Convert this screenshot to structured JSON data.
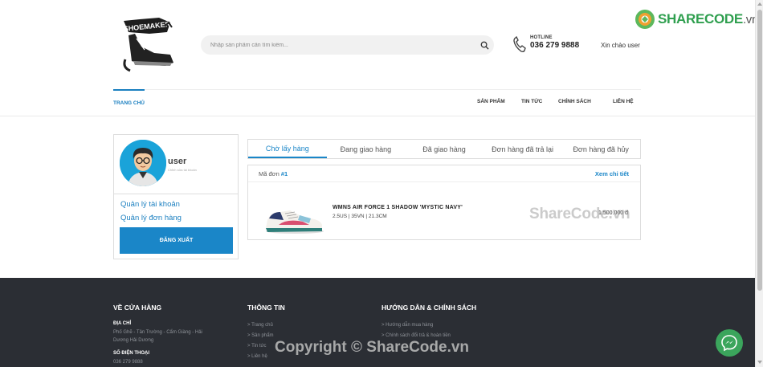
{
  "header": {
    "search_placeholder": "Nhập sản phẩm cần tìm kiếm...",
    "hotline_label": "HOTLINE",
    "hotline_number": "036 279 9888",
    "greeting": "Xin chào user"
  },
  "nav": {
    "home": "TRANG CHỦ",
    "items": [
      "SẢN PHẨM",
      "TIN TỨC",
      "CHÍNH SÁCH",
      "LIÊN HỆ"
    ]
  },
  "profile": {
    "username": "user",
    "subtitle": "Chỉnh sửa tài khoản",
    "manage_account": "Quản lý tài khoản",
    "manage_orders": "Quản lý đơn hàng",
    "logout": "ĐĂNG XUẤT"
  },
  "orders": {
    "tabs": [
      "Chờ lấy hàng",
      "Đang giao hàng",
      "Đã giao hàng",
      "Đơn hàng đã trả lại",
      "Đơn hàng đã hủy"
    ],
    "active_tab": 0,
    "order_label": "Mã đơn",
    "order_id": "#1",
    "detail_link": "Xem chi tiết",
    "product_name": "WMNS AIR FORCE 1 SHADOW 'MYSTIC NAVY'",
    "product_spec": "2.5US | 35VN | 21.3CM",
    "price": "1.500.000 đ"
  },
  "footer": {
    "col1": {
      "title": "VỀ CỬA HÀNG",
      "address_label": "ĐỊA CHỈ",
      "address_line1": "Phố Ghẽ - Tân Trường - Cẩm Giàng - Hải",
      "address_line2": "Dương Hải Dương",
      "phone_label": "SỐ ĐIỆN THOẠI",
      "phone": "036 279 9888"
    },
    "col2": {
      "title": "THÔNG TIN",
      "links": [
        "> Trang chủ",
        "> Sản phẩm",
        "> Tin tức",
        "> Liên hệ"
      ]
    },
    "col3": {
      "title": "HƯỚNG DẪN & CHÍNH SÁCH",
      "links": [
        "> Hướng dẫn mua hàng",
        "> Chính sách đổi trả & hoàn tiền"
      ]
    }
  },
  "watermark": {
    "brand": "SHARECODE",
    "brand_suffix": ".vn",
    "middle": "ShareCode.vn",
    "bottom": "Copyright © ShareCode.vn"
  },
  "colors": {
    "accent": "#1a86c8",
    "footer_bg": "#2b2e34",
    "sharecode_green": "#2f9f4f",
    "messenger_bg": "#3ba55c"
  },
  "icons": [
    "shoemaker-logo",
    "search-icon",
    "phone-icon",
    "sharecode-logo-icon",
    "messenger-icon"
  ]
}
